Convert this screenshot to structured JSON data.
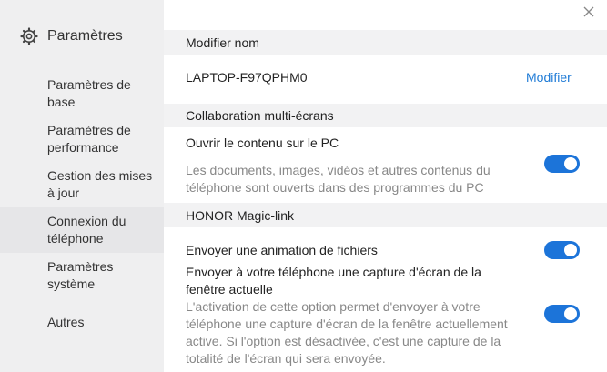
{
  "sidebar": {
    "title": "Paramètres",
    "items": [
      {
        "label": "Paramètres de base"
      },
      {
        "label": "Paramètres de performance"
      },
      {
        "label": "Gestion des mises à jour"
      },
      {
        "label": "Connexion du téléphone"
      },
      {
        "label": "Paramètres système"
      },
      {
        "label": "Autres"
      }
    ]
  },
  "rename": {
    "header": "Modifier nom",
    "device_name": "LAPTOP-F97QPHM0",
    "edit_link": "Modifier"
  },
  "collab": {
    "header": "Collaboration multi-écrans",
    "open_content_title": "Ouvrir le contenu sur le PC",
    "open_content_desc": "Les documents, images, vidéos et autres contenus du téléphone sont ouverts dans des programmes du PC",
    "open_content_enabled": true
  },
  "magiclink": {
    "header": "HONOR Magic-link",
    "send_animation_title": "Envoyer une animation de fichiers",
    "send_animation_enabled": true,
    "send_capture_title": "Envoyer à votre téléphone une capture d'écran de la fenêtre actuelle",
    "send_capture_desc": "L'activation de cette option permet d'envoyer à votre téléphone une capture d'écran de la fenêtre actuellement active. Si l'option est désactivée, c'est une capture de la totalité de l'écran qui sera envoyée.",
    "send_capture_enabled": true
  },
  "colors": {
    "accent": "#1c74d9",
    "link": "#1f7bd6",
    "sidebar_bg": "#efeff0",
    "section_bg": "#f2f2f3"
  }
}
